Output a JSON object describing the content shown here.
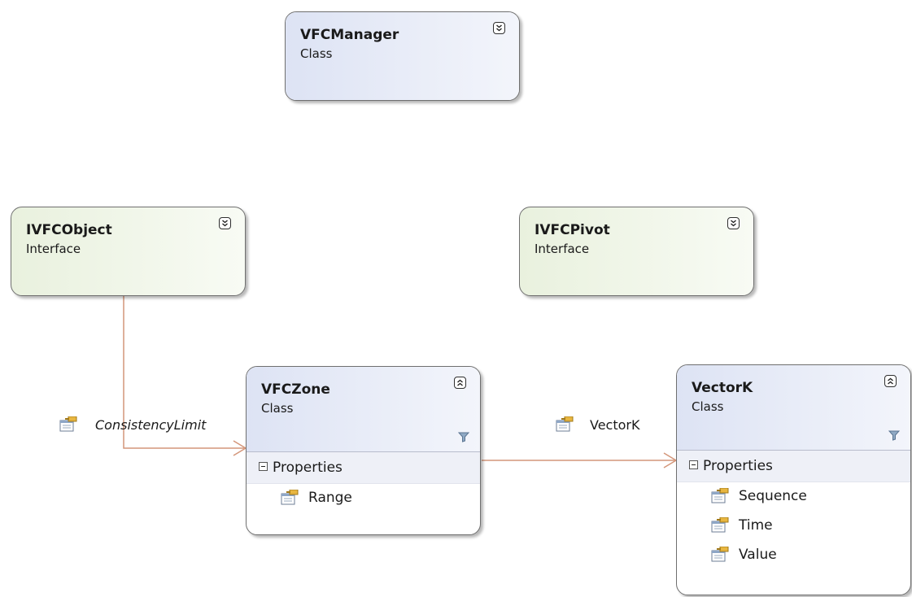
{
  "shapes": {
    "vfcmanager": {
      "name": "VFCManager",
      "kind": "Class"
    },
    "ivfcobject": {
      "name": "IVFCObject",
      "kind": "Interface"
    },
    "ivfcpivot": {
      "name": "IVFCPivot",
      "kind": "Interface"
    },
    "vfczone": {
      "name": "VFCZone",
      "kind": "Class",
      "section": "Properties",
      "members": [
        "Range"
      ]
    },
    "vectork": {
      "name": "VectorK",
      "kind": "Class",
      "section": "Properties",
      "members": [
        "Sequence",
        "Time",
        "Value"
      ]
    }
  },
  "associations": {
    "consistency": {
      "label": "ConsistencyLimit"
    },
    "vectork": {
      "label": "VectorK"
    }
  },
  "colors": {
    "association_line": "#d4967a",
    "class_header": "#dde3f4",
    "interface_fill": "#e9f1de",
    "border": "#6f6f6f"
  },
  "icons": {
    "expand": "chevron-double-down-icon",
    "collapse": "chevron-double-up-icon",
    "filter": "filter-icon",
    "property": "property-icon"
  }
}
